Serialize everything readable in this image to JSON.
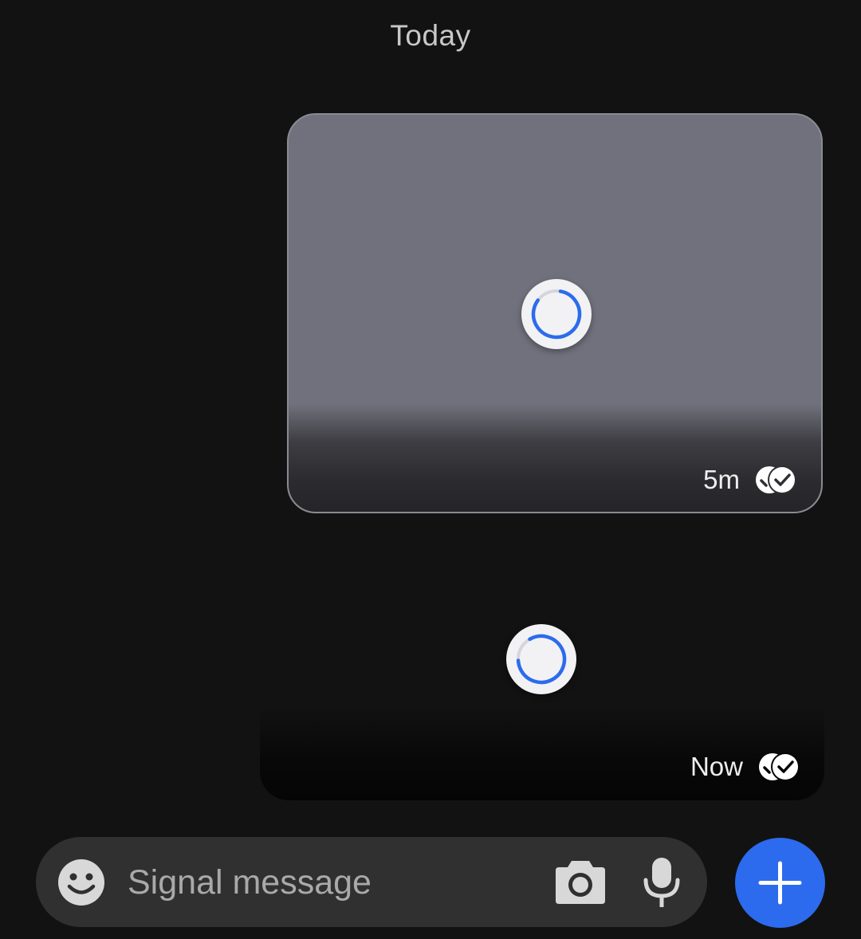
{
  "date_header": "Today",
  "messages": [
    {
      "time": "5m",
      "status_icon": "delivered-double-check-icon",
      "media_state": "loading"
    },
    {
      "time": "Now",
      "status_icon": "delivered-double-check-icon",
      "media_state": "loading"
    }
  ],
  "composer": {
    "placeholder": "Signal message",
    "emoji_icon": "emoji-icon",
    "camera_icon": "camera-icon",
    "mic_icon": "microphone-icon"
  },
  "attach_button": {
    "icon": "plus-icon",
    "color": "#2c6bed"
  },
  "colors": {
    "background": "#121212",
    "accent": "#2c6bed",
    "spinner": "#2c6bed"
  }
}
